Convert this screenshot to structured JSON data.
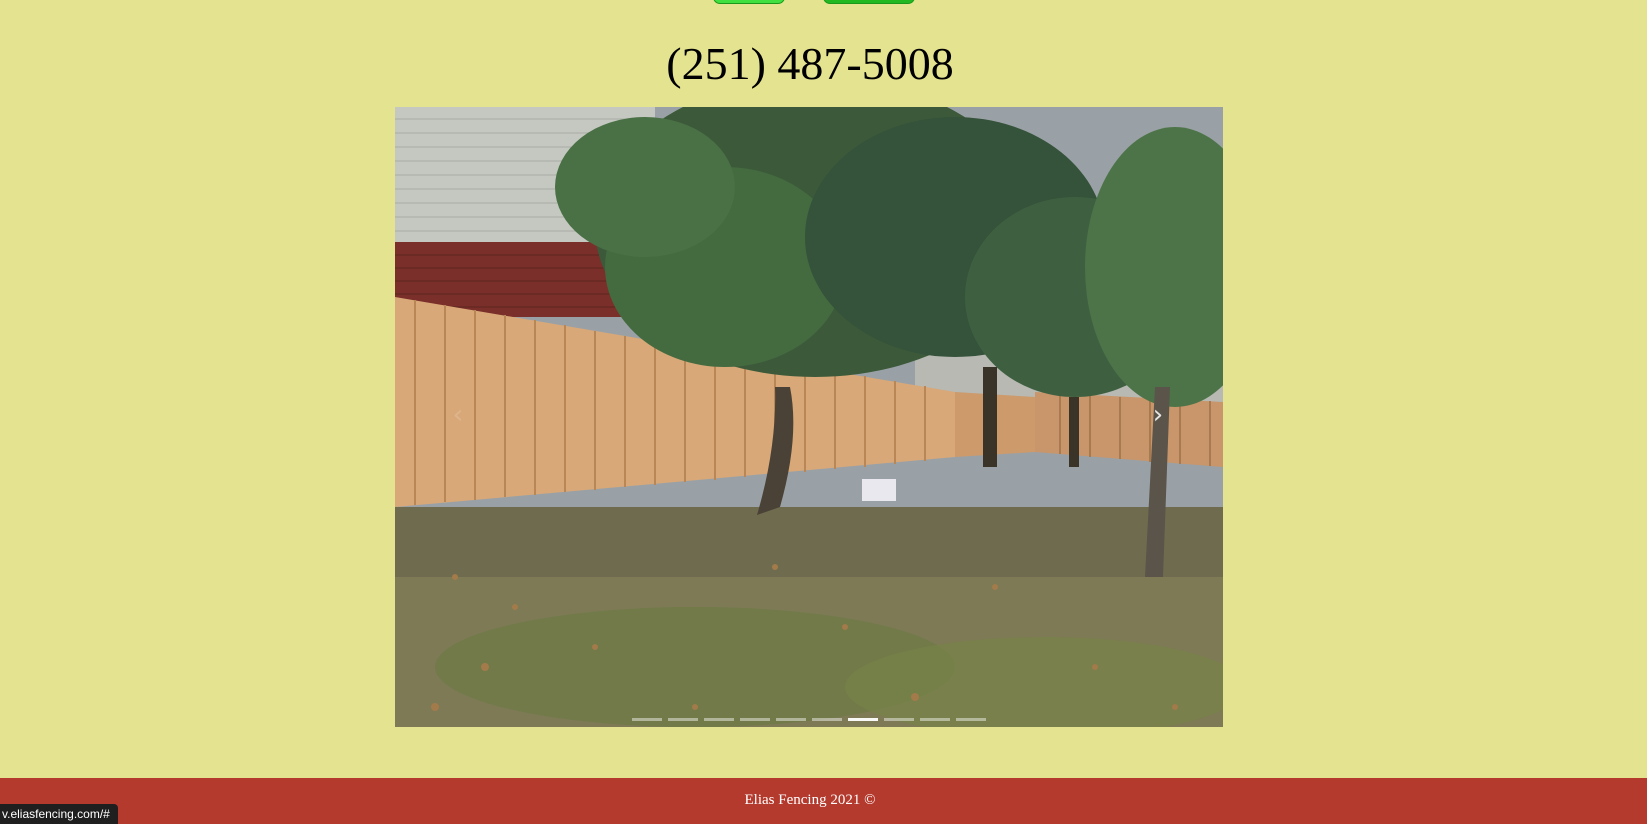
{
  "header": {
    "phone": "(251) 487-5008"
  },
  "carousel": {
    "image_alt": "Wooden privacy fence in backyard with trees",
    "prev_icon": "chevron-left-icon",
    "next_icon": "chevron-right-icon",
    "prev_glyph": "‹",
    "next_glyph": "›",
    "slide_count": 10,
    "active_index": 6
  },
  "footer": {
    "text": "Elias Fencing 2021 ©"
  },
  "status_bar": {
    "url": "v.eliasfencing.com/#"
  },
  "colors": {
    "page_bg": "#e4e38f",
    "footer_bg": "#b43a2e",
    "button_green": "#2ecc2e"
  }
}
